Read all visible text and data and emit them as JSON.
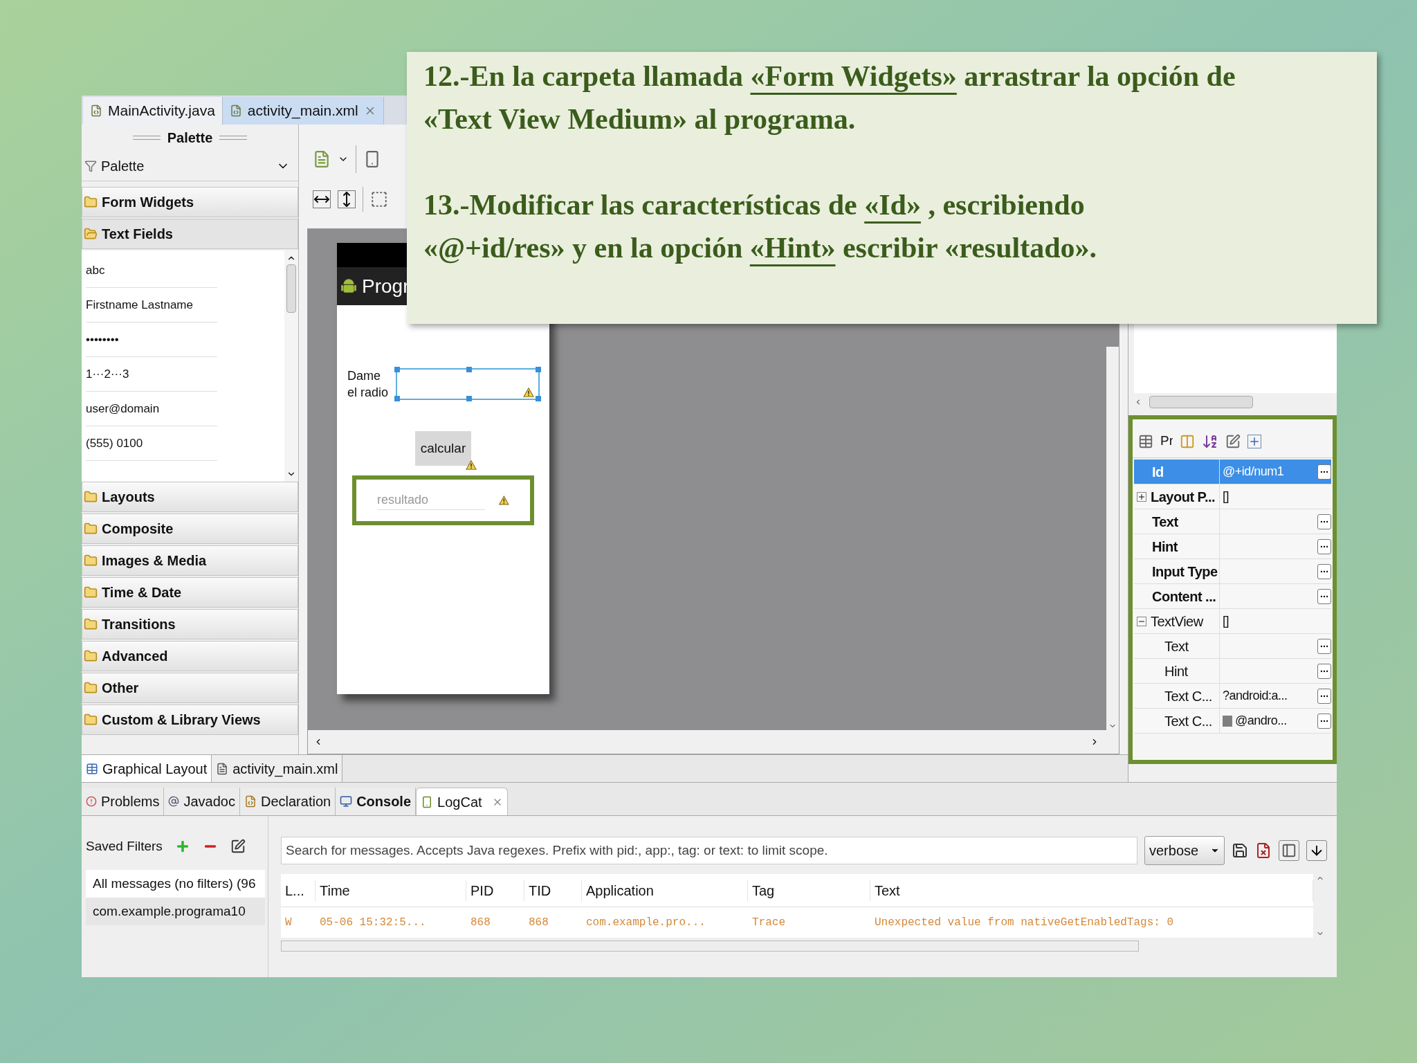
{
  "callout": {
    "steps": [
      {
        "lines": [
          [
            {
              "text": "12.-En la carpeta llamada "
            },
            {
              "text": "«Form Widgets»",
              "underlined": true
            },
            {
              "text": " arrastrar la opción de"
            }
          ],
          [
            {
              "text": "«Text View Medium» al programa."
            }
          ]
        ]
      },
      {
        "lines": [
          [
            {
              "text": "13.-Modificar las características  de "
            },
            {
              "text": "«Id»",
              "underlined": true
            },
            {
              "text": " , escribiendo"
            }
          ],
          [
            {
              "text": "«@+id/res» y en la opción "
            },
            {
              "text": "«Hint»",
              "underlined": true
            },
            {
              "text": " escribir «resultado»."
            }
          ]
        ]
      }
    ]
  },
  "editor_tabs": [
    {
      "label": "MainActivity.java",
      "selected": false,
      "closable": false
    },
    {
      "label": "activity_main.xml",
      "selected": true,
      "closable": true
    }
  ],
  "palette": {
    "title": "Palette",
    "dropdown": "Palette",
    "categories": [
      {
        "label": "Form Widgets",
        "expanded": false
      },
      {
        "label": "Text Fields",
        "expanded": true,
        "items": [
          "abc",
          "Firstname Lastname",
          "••••••••",
          "1···2···3",
          "user@domain",
          "(555) 0100"
        ]
      },
      {
        "label": "Layouts",
        "expanded": false
      },
      {
        "label": "Composite",
        "expanded": false
      },
      {
        "label": "Images & Media",
        "expanded": false
      },
      {
        "label": "Time & Date",
        "expanded": false
      },
      {
        "label": "Transitions",
        "expanded": false
      },
      {
        "label": "Advanced",
        "expanded": false
      },
      {
        "label": "Other",
        "expanded": false
      },
      {
        "label": "Custom & Library Views",
        "expanded": false
      }
    ]
  },
  "phone": {
    "title": "Progr",
    "label": "Dame el radio",
    "button": "calcular",
    "hint": "resultado"
  },
  "layout_tabs": [
    {
      "label": "Graphical Layout",
      "selected": true,
      "kind": "graphical"
    },
    {
      "label": "activity_main.xml",
      "selected": false,
      "kind": "xml"
    }
  ],
  "properties": {
    "toolbar_label": "Pr",
    "rows": [
      {
        "name": "Id",
        "value": "@+id/num1",
        "selected": true,
        "bold": true,
        "button": true
      },
      {
        "name": "Layout P...",
        "value": "[]",
        "selected": false,
        "bold": true,
        "button": false,
        "expanded": false
      },
      {
        "name": "Text",
        "selected": false,
        "bold": true,
        "button": true
      },
      {
        "name": "Hint",
        "selected": false,
        "bold": true,
        "button": true
      },
      {
        "name": "Input Type",
        "selected": false,
        "bold": true,
        "button": true
      },
      {
        "name": "Content ...",
        "selected": false,
        "bold": true,
        "button": true
      },
      {
        "name": "TextView",
        "value": "[]",
        "selected": false,
        "bold": false,
        "button": false,
        "expanded": true,
        "children": [
          {
            "name": "Text",
            "selected": false,
            "bold": false,
            "button": true
          },
          {
            "name": "Hint",
            "selected": false,
            "bold": false,
            "button": true
          },
          {
            "name": "Text C...",
            "value": "?android:a...",
            "selected": false,
            "bold": false,
            "button": true
          },
          {
            "name": "Text C...",
            "value": "@andro...",
            "color": "#7f7f7f",
            "selected": false,
            "bold": false,
            "button": true
          }
        ]
      }
    ]
  },
  "bottom_tabs": [
    {
      "label": "Problems",
      "selected": false,
      "bold": false,
      "kind": "problems"
    },
    {
      "label": "Javadoc",
      "selected": false,
      "bold": false,
      "kind": "javadoc"
    },
    {
      "label": "Declaration",
      "selected": false,
      "bold": false,
      "kind": "declaration"
    },
    {
      "label": "Console",
      "selected": false,
      "bold": true,
      "kind": "console"
    },
    {
      "label": "LogCat",
      "selected": true,
      "bold": false,
      "kind": "logcat"
    }
  ],
  "logcat": {
    "saved_filters": "Saved Filters",
    "filters": [
      {
        "label": "All messages (no filters) (96",
        "selected": false
      },
      {
        "label": "com.example.programa10",
        "selected": true
      }
    ],
    "search": {
      "placeholder": "Search for messages. Accepts Java regexes. Prefix with pid:, app:, tag: or text: to limit scope."
    },
    "level": "verbose",
    "columns": [
      "L...",
      "Time",
      "PID",
      "TID",
      "Application",
      "Tag",
      "Text"
    ],
    "rows": [
      {
        "color": "#d4893a",
        "cells": [
          "W",
          "05-06 15:32:5...",
          "868",
          "868",
          "com.example.pro...",
          "Trace",
          "Unexpected value from nativeGetEnabledTags: 0"
        ]
      }
    ]
  }
}
